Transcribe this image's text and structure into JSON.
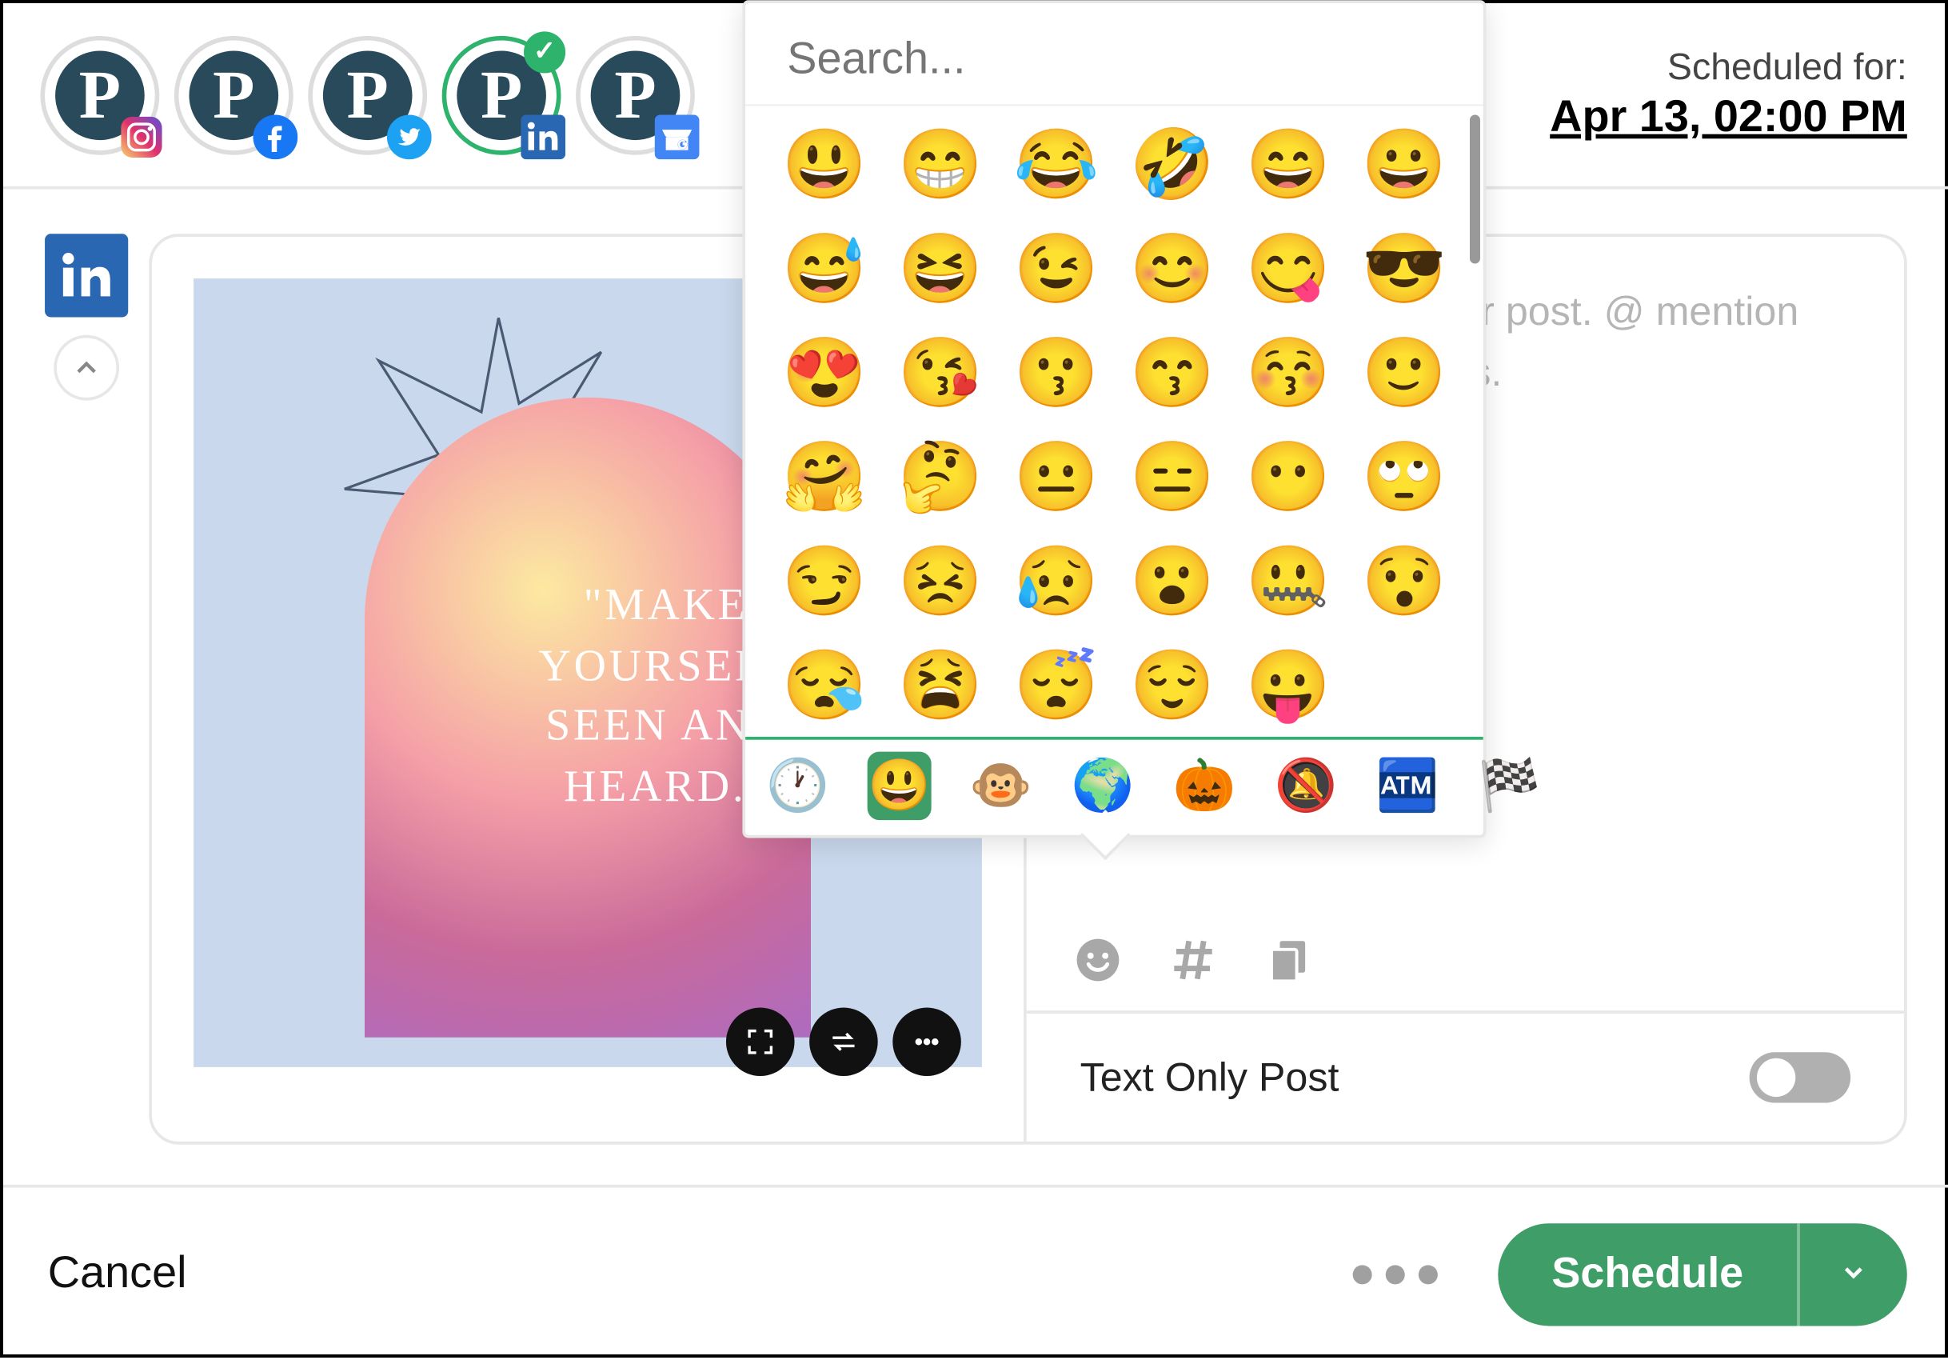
{
  "scheduled": {
    "label": "Scheduled for:",
    "date": "Apr 13, 02:00 PM"
  },
  "accounts": [
    {
      "network": "instagram",
      "selected": false,
      "letter": "P"
    },
    {
      "network": "facebook",
      "selected": false,
      "letter": "P"
    },
    {
      "network": "twitter",
      "selected": false,
      "letter": "P"
    },
    {
      "network": "linkedin",
      "selected": true,
      "letter": "P"
    },
    {
      "network": "google-mb",
      "selected": false,
      "letter": "P"
    },
    {
      "network": "hidden",
      "selected": false,
      "letter": "P"
    }
  ],
  "composer": {
    "placeholder": "Write a caption for your post. @ mention others or add hashtags.",
    "image_quote": "\"MAKE YOURSELF SEEN AND HEARD.\"",
    "text_only_label": "Text Only Post",
    "text_only_on": false
  },
  "emoji_picker": {
    "search_placeholder": "Search...",
    "emojis": [
      "😃",
      "😁",
      "😂",
      "🤣",
      "😄",
      "😀",
      "😅",
      "😆",
      "😉",
      "😊",
      "😋",
      "😎",
      "😍",
      "😘",
      "😗",
      "😙",
      "😚",
      "🙂",
      "🤗",
      "🤔",
      "😐",
      "😑",
      "😶",
      "🙄",
      "😏",
      "😣",
      "😥",
      "😮",
      "🤐",
      "😯",
      "😪",
      "😫",
      "😴",
      "😌",
      "😛"
    ],
    "category_tabs": [
      {
        "icon": "🕐",
        "name": "recent",
        "active": false
      },
      {
        "icon": "😃",
        "name": "smileys",
        "active": true
      },
      {
        "icon": "🐵",
        "name": "animals",
        "active": false
      },
      {
        "icon": "🌍",
        "name": "travel",
        "active": false
      },
      {
        "icon": "🎃",
        "name": "activity",
        "active": false
      },
      {
        "icon": "🔕",
        "name": "symbols",
        "active": false
      },
      {
        "icon": "🏧",
        "name": "objects",
        "active": false
      },
      {
        "icon": "🏁",
        "name": "flags",
        "active": false
      }
    ]
  },
  "editor_tools": [
    "emoji",
    "hashtag",
    "copy"
  ],
  "image_tools": [
    "expand",
    "swap",
    "more"
  ],
  "footer": {
    "cancel": "Cancel",
    "schedule": "Schedule"
  }
}
